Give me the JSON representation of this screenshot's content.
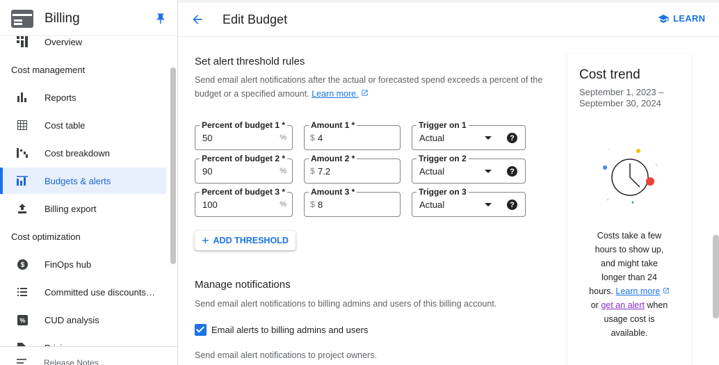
{
  "sidebar": {
    "title": "Billing",
    "items": [
      {
        "label": "Overview",
        "icon": "overview-icon"
      },
      {
        "label": "Reports",
        "icon": "bar-chart-icon"
      },
      {
        "label": "Cost table",
        "icon": "table-icon"
      },
      {
        "label": "Cost breakdown",
        "icon": "waterfall-icon"
      },
      {
        "label": "Budgets & alerts",
        "icon": "budget-icon",
        "active": true
      },
      {
        "label": "Billing export",
        "icon": "export-icon"
      },
      {
        "label": "FinOps hub",
        "icon": "dollar-icon"
      },
      {
        "label": "Committed use discounts…",
        "icon": "list-icon"
      },
      {
        "label": "CUD analysis",
        "icon": "percent-icon"
      },
      {
        "label": "Pricing",
        "icon": "tag-icon"
      }
    ],
    "sections": {
      "cost_management": "Cost management",
      "cost_optimization": "Cost optimization"
    },
    "release_notes": "Release Notes"
  },
  "header": {
    "title": "Edit Budget",
    "learn_label": "LEARN"
  },
  "threshold": {
    "heading": "Set alert threshold rules",
    "description": "Send email alert notifications after the actual or forecasted spend exceeds a percent of the budget or a specified amount.",
    "learn_more": "Learn more.",
    "rows": [
      {
        "percent_label": "Percent of budget 1 *",
        "percent": "50",
        "amount_label": "Amount 1 *",
        "amount": "4",
        "trigger_label": "Trigger on 1",
        "trigger": "Actual"
      },
      {
        "percent_label": "Percent of budget 2 *",
        "percent": "90",
        "amount_label": "Amount 2 *",
        "amount": "7.2",
        "trigger_label": "Trigger on 2",
        "trigger": "Actual"
      },
      {
        "percent_label": "Percent of budget 3 *",
        "percent": "100",
        "amount_label": "Amount 3 *",
        "amount": "8",
        "trigger_label": "Trigger on 3",
        "trigger": "Actual"
      }
    ],
    "percent_suffix": "%",
    "currency_prefix": "$",
    "add_label": "ADD THRESHOLD"
  },
  "notifications": {
    "heading": "Manage notifications",
    "description": "Send email alert notifications to billing admins and users of this billing account.",
    "checkbox_label": "Email alerts to billing admins and users",
    "checkbox_checked": true,
    "owners_text": "Send email alert notifications to project owners."
  },
  "trend": {
    "title": "Cost trend",
    "date_range": "September 1, 2023 – September 30, 2024",
    "message_part1": "Costs take a few hours to show up, and might take longer than 24 hours.",
    "learn_more": "Learn more",
    "or_text": "or",
    "alert_link": "get an alert",
    "message_part2": "when usage cost is available."
  },
  "colors": {
    "accent": "#1a73e8",
    "active_bg": "#e8f0fe",
    "alert_link": "#8430ce"
  }
}
